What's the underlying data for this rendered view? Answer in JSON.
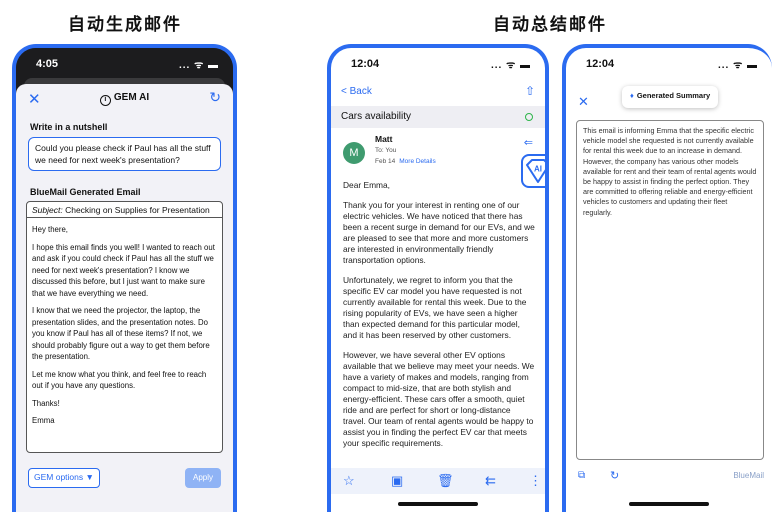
{
  "titles": {
    "left": "自动生成邮件",
    "right": "自动总结邮件"
  },
  "colors": {
    "accent": "#2b6bf0",
    "avatar": "#3f9b6f",
    "status_dot": "#2db54a"
  },
  "phone1": {
    "time": "4:05",
    "status_icons": "... ᯤ ▬",
    "close": "✕",
    "header_title": "GEM AI",
    "info_icon": "i",
    "refresh": "↻",
    "nutshell_label": "Write in a nutshell",
    "nutshell_text": "Could you please check if Paul has all the stuff we need for next week's presentation?",
    "generated_label": "BlueMail Generated Email",
    "subject_prefix": "Subject:",
    "subject_text": " Checking on Supplies for Presentation",
    "body": [
      "Hey there,",
      "I hope this email finds you well! I wanted to reach out and ask if you could check if Paul has all the stuff we need for next week's presentation? I know we discussed this before, but I just want to make sure that we have everything we need.",
      "I know that we need the projector, the laptop, the presentation slides, and the presentation notes. Do you know if Paul has all of these items? If not, we should probably figure out a way to get them before the presentation.",
      "Let me know what you think, and feel free to reach out if you have any questions.",
      "Thanks!",
      "Emma"
    ],
    "gem_options": "GEM options ▼",
    "apply": "Apply"
  },
  "phone2": {
    "time": "12:04",
    "status_icons": "... ᯤ ▬",
    "back": "< Back",
    "share": "⇧",
    "subject": "Cars availability",
    "avatar_letter": "M",
    "sender": "Matt",
    "to": "To: You",
    "date": "Feb 14",
    "more_details": "More Details",
    "reply": "⇐",
    "ai_label": "AI",
    "body": [
      "Dear Emma,",
      "Thank you for your interest in renting one of our electric vehicles. We have noticed that there has been a recent surge in demand for our EVs, and we are pleased to see that more and more customers are interested in environmentally friendly transportation options.",
      "Unfortunately, we regret to inform you that the specific EV car model you have requested is not currently available for rental this week. Due to the rising popularity of EVs, we have seen a higher than expected demand for this particular model, and it has been reserved by other customers.",
      "However, we have several other EV options available that we believe may meet your needs. We have a variety of makes and models, ranging from compact to mid-size, that are both stylish and energy-efficient. These cars offer a smooth, quiet ride and are perfect for short or long-distance travel. Our team of rental agents would be happy to assist you in finding the perfect EV car that meets your specific requirements."
    ],
    "toolbar": {
      "star": "☆",
      "archive": "▣",
      "trash": "🗑",
      "reply_all": "⇇",
      "more": "⋮"
    }
  },
  "phone3": {
    "time": "12:04",
    "status_icons": "... ᯤ ▬",
    "pill_icon": "♦",
    "pill_label": "Generated Summary",
    "close": "✕",
    "summary": "This email is informing Emma that the specific electric vehicle model she requested is not currently available for rental this week due to an increase in demand. However, the company has various other models available for rent and their team of rental agents would be happy to assist in finding the perfect option. They are committed to offering reliable and energy-efficient vehicles to customers and updating their fleet regularly.",
    "copy": "⧉",
    "refresh": "↻",
    "brand": "BlueMail"
  }
}
